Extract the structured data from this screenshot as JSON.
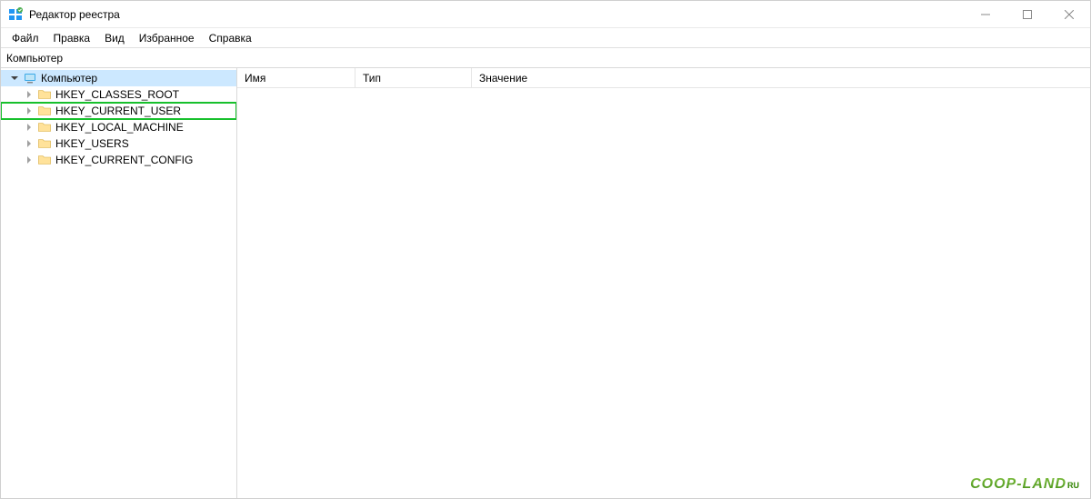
{
  "window": {
    "title": "Редактор реестра"
  },
  "menu": {
    "items": [
      "Файл",
      "Правка",
      "Вид",
      "Избранное",
      "Справка"
    ]
  },
  "addressbar": {
    "path": "Компьютер"
  },
  "tree": {
    "root": {
      "label": "Компьютер",
      "expanded": true,
      "selected": true
    },
    "children": [
      {
        "label": "HKEY_CLASSES_ROOT",
        "highlighted": false
      },
      {
        "label": "HKEY_CURRENT_USER",
        "highlighted": true
      },
      {
        "label": "HKEY_LOCAL_MACHINE",
        "highlighted": false
      },
      {
        "label": "HKEY_USERS",
        "highlighted": false
      },
      {
        "label": "HKEY_CURRENT_CONFIG",
        "highlighted": false
      }
    ]
  },
  "list": {
    "columns": [
      {
        "label": "Имя",
        "width": 130
      },
      {
        "label": "Тип",
        "width": 128
      },
      {
        "label": "Значение",
        "width": 0
      }
    ]
  },
  "watermark": {
    "text": "COOP-LAND",
    "suffix": "RU"
  }
}
